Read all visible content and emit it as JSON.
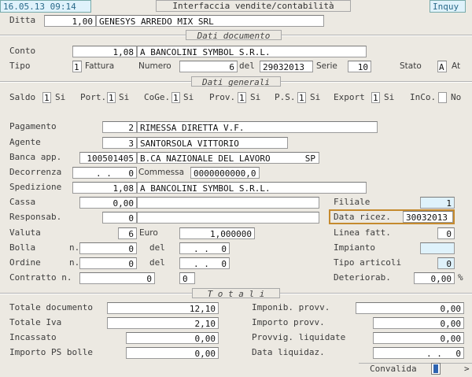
{
  "header": {
    "datetime": "16.05.13 09:14",
    "title": "Interfaccia vendite/contabilità",
    "mode": "Inquy"
  },
  "ditta": {
    "label": "Ditta",
    "code": "1,00",
    "name": "GENESYS ARREDO MIX SRL"
  },
  "sections": {
    "documento": "Dati documento",
    "generali": "Dati generali",
    "totali": "T o t a l i"
  },
  "documento": {
    "conto_label": "Conto",
    "conto_code": "1,08",
    "conto_name": "A BANCOLINI SYMBOL S.R.L.",
    "tipo_label": "Tipo",
    "tipo_value": "1",
    "tipo_desc": "Fattura",
    "numero_label": "Numero",
    "numero_value": "6",
    "del_label": "del",
    "del_value": "29032013",
    "serie_label": "Serie",
    "serie_value": "10",
    "stato_label": "Stato",
    "stato_value": "A",
    "stato_desc": "At"
  },
  "flags": {
    "saldo_label": "Saldo",
    "saldo_value": "1",
    "saldo_desc": "Si",
    "port_label": "Port.",
    "port_value": "1",
    "port_desc": "Si",
    "coge_label": "CoGe.",
    "coge_value": "1",
    "coge_desc": "Si",
    "prov_label": "Prov.",
    "prov_value": "1",
    "prov_desc": "Si",
    "ps_label": "P.S.",
    "ps_value": "1",
    "ps_desc": "Si",
    "export_label": "Export",
    "export_value": "1",
    "export_desc": "Si",
    "inco_label": "InCo.",
    "inco_value": "",
    "inco_desc": "No"
  },
  "generali": {
    "pagamento_label": "Pagamento",
    "pagamento_code": "2",
    "pagamento_desc": "RIMESSA DIRETTA V.F.",
    "agente_label": "Agente",
    "agente_code": "3",
    "agente_desc": "SANTORSOLA VITTORIO",
    "banca_label": "Banca app.",
    "banca_code": "100501405",
    "banca_desc": "B.CA NAZIONALE DEL LAVORO",
    "banca_suffix": "SP",
    "decorrenza_label": "Decorrenza",
    "decorrenza_value": ". .",
    "decorrenza_num": "0",
    "commessa_label": "Commessa",
    "commessa_value": "0000000000,0",
    "spedizione_label": "Spedizione",
    "spedizione_code": "1,08",
    "spedizione_desc": "A BANCOLINI SYMBOL S.R.L.",
    "cassa_label": "Cassa",
    "cassa_value": "0,00",
    "respons_label": "Responsab.",
    "respons_value": "0",
    "valuta_label": "Valuta",
    "valuta_code": "6",
    "valuta_desc": "Euro",
    "valuta_rate": "1,000000",
    "bolla_label": "Bolla",
    "bolla_n_label": "n.",
    "bolla_n": "0",
    "bolla_del_label": "del",
    "bolla_del": ". .",
    "bolla_del_num": "0",
    "ordine_label": "Ordine",
    "ordine_n_label": "n.",
    "ordine_n": "0",
    "ordine_del_label": "del",
    "ordine_del": ". .",
    "ordine_del_num": "0",
    "contratto_label": "Contratto n.",
    "contratto_n": "0",
    "contratto_2": "0",
    "filiale_label": "Filiale",
    "filiale_value": "1",
    "data_ricez_label": "Data ricez.",
    "data_ricez_value": "30032013",
    "linea_label": "Linea fatt.",
    "linea_value": "0",
    "impianto_label": "Impianto",
    "impianto_value": "",
    "tipo_art_label": "Tipo articoli",
    "tipo_art_value": "0",
    "deterior_label": "Deteriorab.",
    "deterior_value": "0,00",
    "deterior_unit": "%"
  },
  "totali": {
    "totale_doc_label": "Totale documento",
    "totale_doc": "12,10",
    "totale_iva_label": "Totale Iva",
    "totale_iva": "2,10",
    "incassato_label": "Incassato",
    "incassato": "0,00",
    "importo_ps_label": "Importo PS bolle",
    "importo_ps": "0,00",
    "imponib_label": "Imponib. provv.",
    "imponib": "0,00",
    "importo_provv_label": "Importo  provv.",
    "importo_provv": "0,00",
    "provvig_label": "Provvig. liquidate",
    "provvig": "0,00",
    "data_liq_label": "Data    liquidaz.",
    "data_liq": ". .",
    "data_liq_num": "0"
  },
  "footer": {
    "convalida_label": "Convalida",
    "arrow": ">"
  }
}
